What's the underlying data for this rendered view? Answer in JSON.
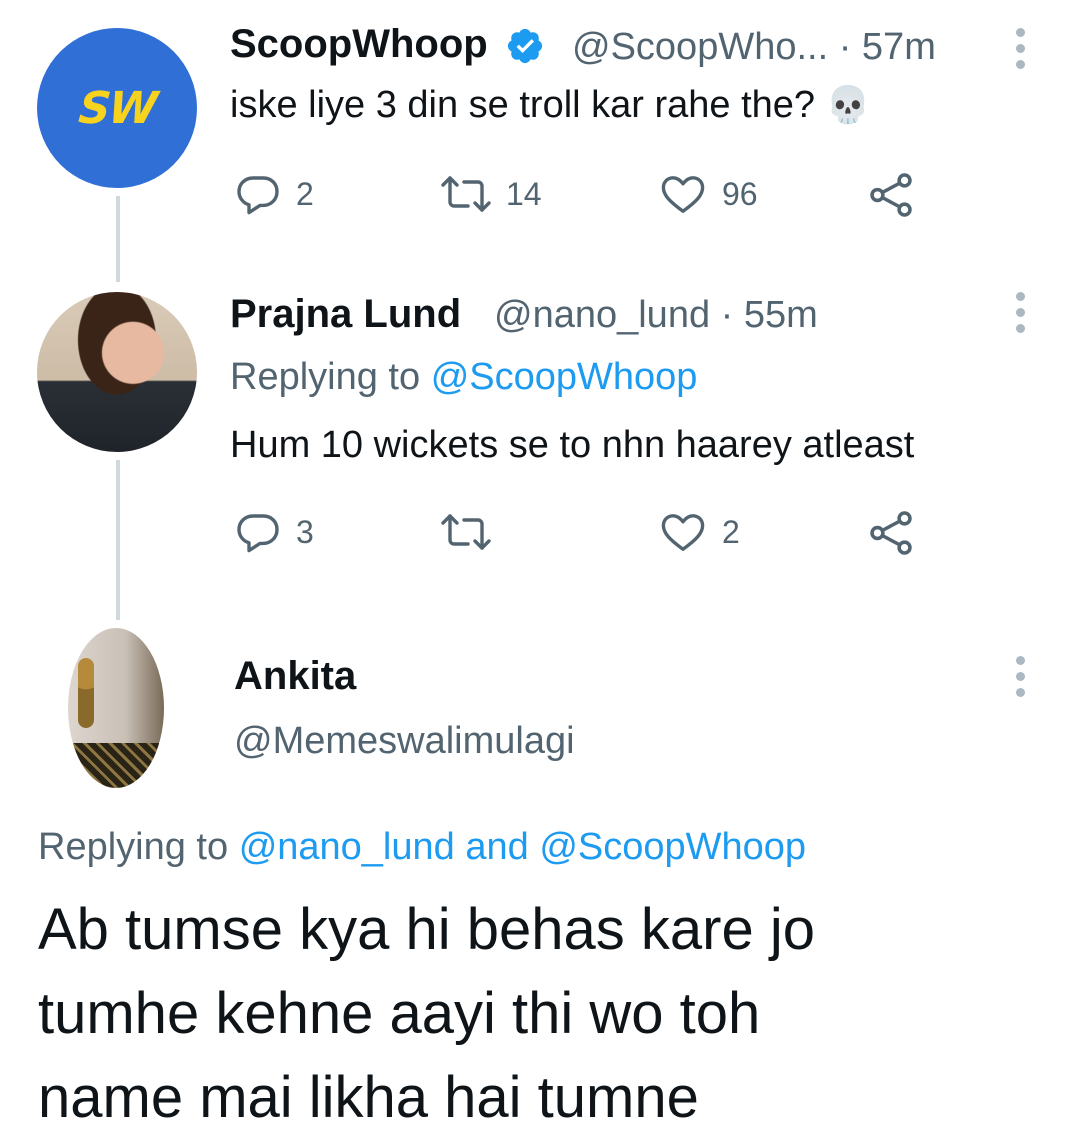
{
  "tweets": [
    {
      "avatar_text": "SW",
      "name": "ScoopWhoop",
      "handle": "@ScoopWho...",
      "separator": "·",
      "time": "57m",
      "text": "iske liye 3 din se troll kar rahe the?",
      "emoji": "💀",
      "replies": "2",
      "retweets": "14",
      "likes": "96"
    },
    {
      "name": "Prajna Lund",
      "handle": "@nano_lund",
      "separator": "·",
      "time": "55m",
      "replying_prefix": "Replying to",
      "replying_to": "@ScoopWhoop",
      "text": "Hum 10 wickets se to nhn haarey atleast",
      "replies": "3",
      "retweets": "",
      "likes": "2"
    }
  ],
  "main_tweet": {
    "name": "Ankita",
    "handle": "@Memeswalimulagi",
    "replying_prefix": "Replying to",
    "replying_to_1": "@nano_lund",
    "replying_and": "and",
    "replying_to_2": "@ScoopWhoop",
    "text_line_1": "Ab tumse kya hi behas kare jo",
    "text_line_2": "tumhe kehne aayi thi wo toh",
    "text_line_3": "name mai likha hai tumne"
  },
  "colors": {
    "link": "#1d9bf0",
    "muted": "#536471",
    "text": "#0f1419",
    "verified": "#1d9bf0",
    "scoopwhoop_bg": "#2f6fd6",
    "scoopwhoop_fg": "#f7d21e"
  },
  "icons": [
    "reply-icon",
    "retweet-icon",
    "like-icon",
    "share-icon",
    "more-icon",
    "verified-badge-icon"
  ]
}
